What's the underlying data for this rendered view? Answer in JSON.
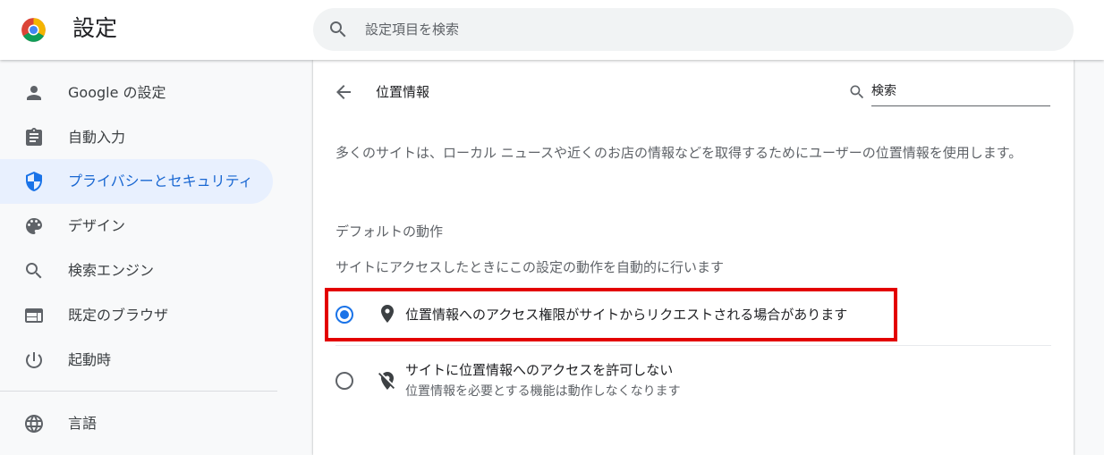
{
  "header": {
    "app_title": "設定",
    "search_placeholder": "設定項目を検索"
  },
  "sidebar": {
    "items": [
      {
        "label": "Google の設定",
        "icon": "person-icon"
      },
      {
        "label": "自動入力",
        "icon": "clipboard-icon"
      },
      {
        "label": "プライバシーとセキュリティ",
        "icon": "shield-icon",
        "active": true
      },
      {
        "label": "デザイン",
        "icon": "palette-icon"
      },
      {
        "label": "検索エンジン",
        "icon": "search-icon"
      },
      {
        "label": "既定のブラウザ",
        "icon": "browser-window-icon"
      },
      {
        "label": "起動時",
        "icon": "power-icon"
      },
      {
        "label": "言語",
        "icon": "globe-icon"
      }
    ]
  },
  "main": {
    "title": "位置情報",
    "search_placeholder": "検索",
    "description": "多くのサイトは、ローカル ニュースや近くのお店の情報などを取得するためにユーザーの位置情報を使用します。",
    "default_behavior_title": "デフォルトの動作",
    "default_behavior_subtitle": "サイトにアクセスしたときにこの設定の動作を自動的に行います",
    "options": [
      {
        "label": "位置情報へのアクセス権限がサイトからリクエストされる場合があります",
        "sublabel": "",
        "selected": true,
        "icon": "location-pin-icon"
      },
      {
        "label": "サイトに位置情報へのアクセスを許可しない",
        "sublabel": "位置情報を必要とする機能は動作しなくなります",
        "selected": false,
        "icon": "location-off-icon"
      }
    ]
  },
  "colors": {
    "accent": "#1a73e8",
    "active_bg": "#e8f0fe",
    "highlight_border": "#e30000"
  }
}
